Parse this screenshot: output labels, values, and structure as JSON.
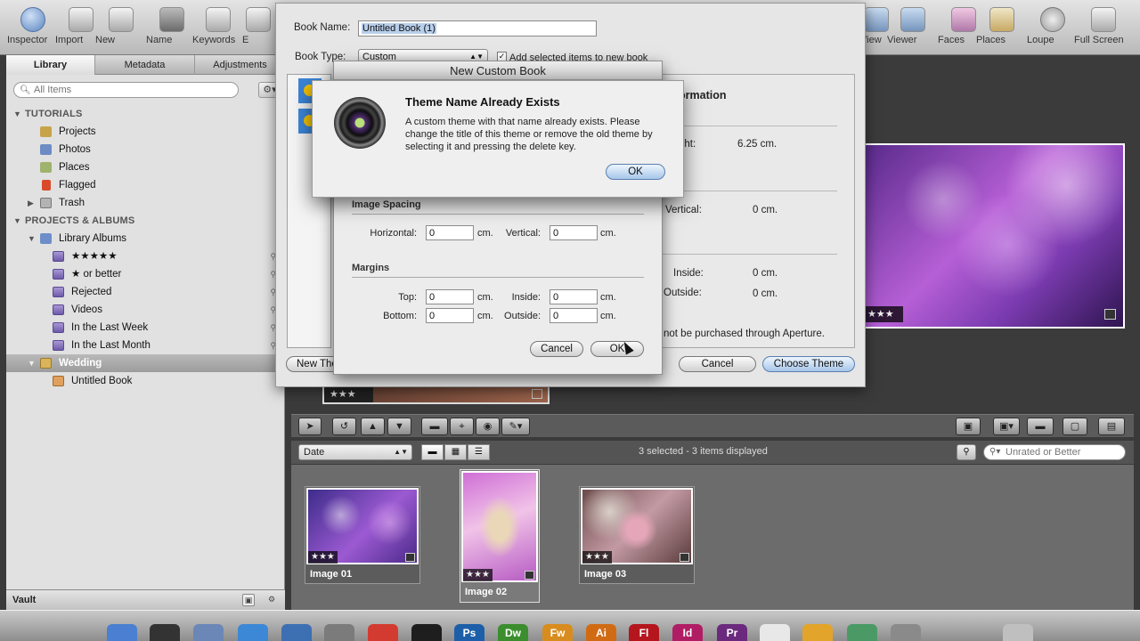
{
  "toolbar": {
    "left": [
      {
        "label": "Inspector",
        "icon": "info-icon"
      },
      {
        "label": "Import",
        "icon": "import-arrow-icon"
      },
      {
        "label": "New",
        "icon": "new-folder-icon"
      },
      {
        "label": "Name",
        "icon": "name-person-icon"
      },
      {
        "label": "Keywords",
        "icon": "keyword-tag-icon"
      },
      {
        "label": "E",
        "icon": "email-icon"
      }
    ],
    "right": [
      {
        "label": "View",
        "icon": "view-icon"
      },
      {
        "label": "Viewer",
        "icon": "viewer-icon"
      },
      {
        "label": "Faces",
        "icon": "faces-icon"
      },
      {
        "label": "Places",
        "icon": "places-icon"
      },
      {
        "label": "Loupe",
        "icon": "loupe-icon"
      },
      {
        "label": "Full Screen",
        "icon": "full-screen-icon"
      }
    ]
  },
  "left_panel": {
    "tabs": [
      "Library",
      "Metadata",
      "Adjustments"
    ],
    "search_placeholder": "All Items",
    "sections": {
      "tutorials": "TUTORIALS",
      "projects_albums": "PROJECTS & ALBUMS"
    },
    "tutorial_items": [
      "Projects",
      "Photos",
      "Places",
      "Flagged",
      "Trash"
    ],
    "library_albums_label": "Library Albums",
    "album_items": [
      "★★★★★",
      "★ or better",
      "Rejected",
      "Videos",
      "In the Last Week",
      "In the Last Month"
    ],
    "project": "Wedding",
    "book": "Untitled Book",
    "vault_label": "Vault"
  },
  "book_sheet": {
    "book_name_label": "Book Name:",
    "book_name_value": "Untitled Book (1)",
    "book_type_label": "Book Type:",
    "book_type_value": "Custom",
    "add_selected_label": "Add selected items to new book",
    "add_selected_checked": true,
    "info_heading": "ormation",
    "height_label": "ght:",
    "height_value": "6.25 cm.",
    "vertical_label": "Vertical:",
    "vertical_value": "0 cm.",
    "inside_label": "Inside:",
    "inside_value": "0 cm.",
    "outside_label": "Outside:",
    "outside_value": "0 cm.",
    "purchase_note": "not be purchased through Aperture.",
    "new_theme_label": "New The",
    "cancel_label": "Cancel",
    "choose_theme_label": "Choose Theme"
  },
  "new_custom_book": {
    "title": "New Custom Book",
    "image_spacing_label": "Image Spacing",
    "horizontal_label": "Horizontal:",
    "horizontal_value": "0",
    "vertical_label": "Vertical:",
    "vertical_value": "0",
    "margins_label": "Margins",
    "top_label": "Top:",
    "top_value": "0",
    "inside_label": "Inside:",
    "inside_value": "0",
    "bottom_label": "Bottom:",
    "bottom_value": "0",
    "outside_label": "Outside:",
    "outside_value": "0",
    "unit": "cm.",
    "cancel_label": "Cancel",
    "ok_label": "OK"
  },
  "alert": {
    "title": "Theme Name Already Exists",
    "message": "A custom theme with that name already exists. Please change the title of this theme or remove the old theme by selecting it and pressing the delete key.",
    "ok_label": "OK",
    "icon": "aperture-lens-icon"
  },
  "viewer": {
    "hero_stars": "★★★",
    "strip_stars": "★★★"
  },
  "browser": {
    "sort_value": "Date",
    "status": "3 selected - 3 items displayed",
    "filter_placeholder": "Unrated or Better",
    "images": [
      {
        "name": "Image 01",
        "stars": "★★★"
      },
      {
        "name": "Image 02",
        "stars": "★★★"
      },
      {
        "name": "Image 03",
        "stars": "★★★"
      }
    ]
  },
  "dock": [
    {
      "name": "finder-icon",
      "label": "",
      "color": "#4a7fd1"
    },
    {
      "name": "dashboard-icon",
      "label": "",
      "color": "#333333"
    },
    {
      "name": "preview-icon",
      "label": "",
      "color": "#6b87b8"
    },
    {
      "name": "safari-icon",
      "label": "",
      "color": "#3c88d6"
    },
    {
      "name": "itunes-icon",
      "label": "",
      "color": "#3d6fb3"
    },
    {
      "name": "system-prefs-icon",
      "label": "",
      "color": "#7b7b7b"
    },
    {
      "name": "calendar-icon",
      "label": "",
      "color": "#d33b30"
    },
    {
      "name": "aperture-icon",
      "label": "",
      "color": "#1e1e1e"
    },
    {
      "name": "photoshop-icon",
      "label": "Ps",
      "color": "#1c5fa8"
    },
    {
      "name": "dreamweaver-icon",
      "label": "Dw",
      "color": "#3c8d2e"
    },
    {
      "name": "fireworks-icon",
      "label": "Fw",
      "color": "#d98c1e"
    },
    {
      "name": "illustrator-icon",
      "label": "Ai",
      "color": "#d06b14"
    },
    {
      "name": "flash-icon",
      "label": "Fl",
      "color": "#b5161e"
    },
    {
      "name": "indesign-icon",
      "label": "Id",
      "color": "#b01d64"
    },
    {
      "name": "premiere-icon",
      "label": "Pr",
      "color": "#6b2a7d"
    },
    {
      "name": "textedit-icon",
      "label": "",
      "color": "#e8e8e8"
    },
    {
      "name": "growl-icon",
      "label": "",
      "color": "#e3a42b"
    },
    {
      "name": "time-machine-icon",
      "label": "",
      "color": "#4b9a66"
    },
    {
      "name": "app-store-icon",
      "label": "",
      "color": "#8a8a8a"
    },
    {
      "name": "trash-dock-icon",
      "label": "",
      "color": "#bfbfbf"
    }
  ]
}
